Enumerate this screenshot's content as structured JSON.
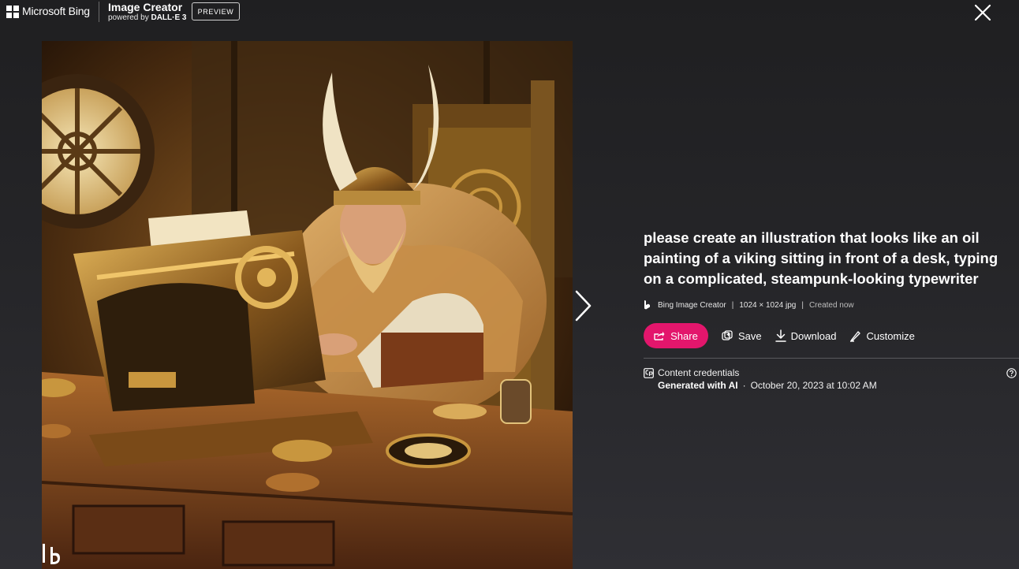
{
  "header": {
    "brand": "Microsoft Bing",
    "app_title": "Image Creator",
    "app_subtitle_prefix": "powered by ",
    "app_subtitle_model": "DALL·E 3",
    "preview_badge": "PREVIEW"
  },
  "image": {
    "alt": "Oil painting of a viking with horned helmet and fur collar typing on an ornate steampunk typewriter"
  },
  "details": {
    "prompt": "please create an illustration that looks like an oil painting of a viking sitting in front of a desk, typing on a complicated, steampunk-looking typewriter",
    "source": "Bing Image Creator",
    "sep1": "|",
    "dimensions": "1024 × 1024 jpg",
    "sep2": "|",
    "created": "Created now"
  },
  "actions": {
    "share": "Share",
    "save": "Save",
    "download": "Download",
    "customize": "Customize"
  },
  "credentials": {
    "title": "Content credentials",
    "generated": "Generated with AI",
    "dot": "·",
    "date": "October 20, 2023 at 10:02 AM"
  },
  "colors": {
    "share_button": "#e3166c",
    "background": "#252528"
  },
  "icons": [
    "windows-logo-icon",
    "close-icon",
    "chevron-right-icon",
    "bing-logo-icon",
    "share-icon",
    "save-icon",
    "download-icon",
    "customize-icon",
    "content-credentials-icon",
    "help-icon"
  ]
}
